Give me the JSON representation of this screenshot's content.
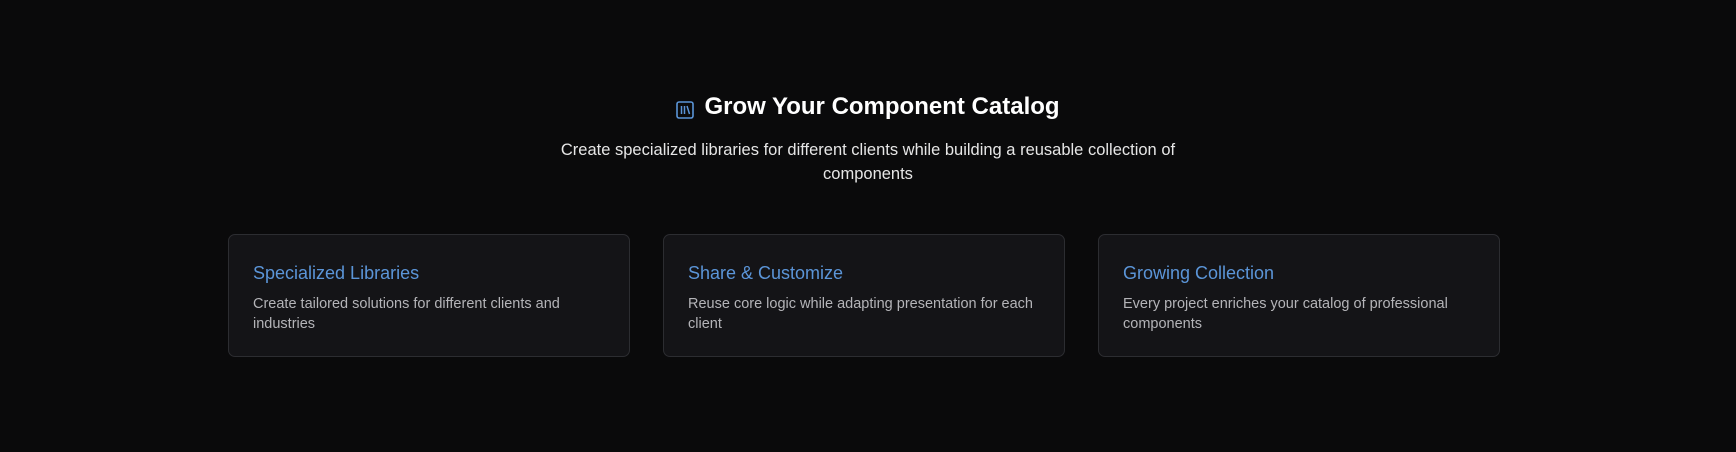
{
  "header": {
    "icon": "library-icon",
    "title": "Grow Your Component Catalog",
    "subtitle": "Create specialized libraries for different clients while building a reusable collection of components"
  },
  "cards": [
    {
      "title": "Specialized Libraries",
      "description": "Create tailored solutions for different clients and industries"
    },
    {
      "title": "Share & Customize",
      "description": "Reuse core logic while adapting presentation for each client"
    },
    {
      "title": "Growing Collection",
      "description": "Every project enriches your catalog of professional components"
    }
  ],
  "colors": {
    "accent": "#5b95d8",
    "background": "#0a0a0b",
    "card": "#141417"
  }
}
